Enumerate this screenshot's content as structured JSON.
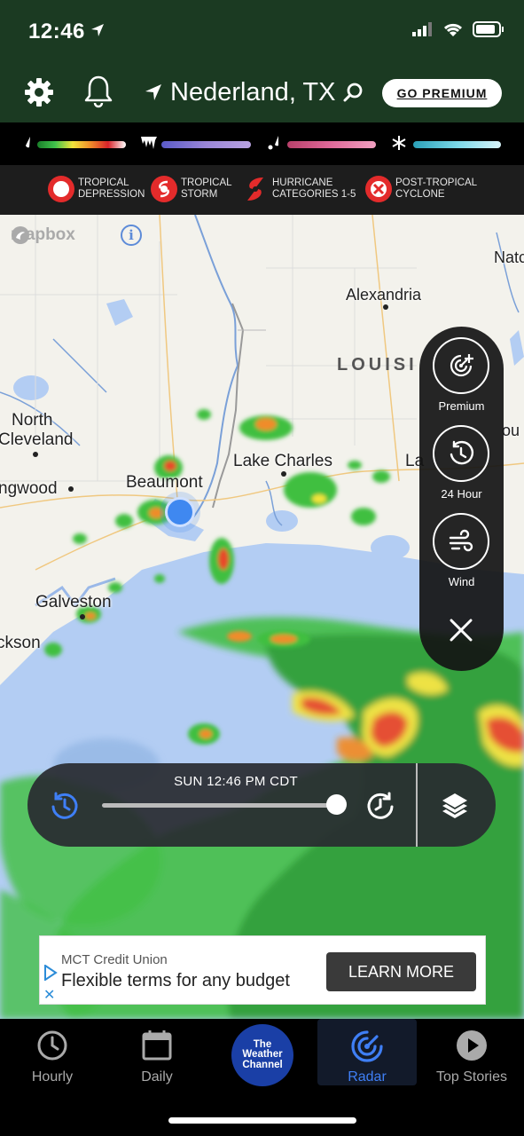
{
  "status_bar": {
    "time": "12:46"
  },
  "header": {
    "location": "Nederland, TX",
    "premium_button": "GO PREMIUM"
  },
  "legend": {
    "gradients": [
      {
        "name": "rain",
        "icon": "raindrop-icon",
        "colors": [
          "#1a7f2a",
          "#3fc24a",
          "#f2e43b",
          "#f08c2a",
          "#d8222a",
          "#ffffff"
        ]
      },
      {
        "name": "ice",
        "icon": "icicle-icon",
        "colors": [
          "#5a5ac8",
          "#9a86d8",
          "#b8a2e0"
        ]
      },
      {
        "name": "mix",
        "icon": "mix-icon",
        "colors": [
          "#b8406a",
          "#e06a9a",
          "#f0a0c0"
        ]
      },
      {
        "name": "snow",
        "icon": "snowflake-icon",
        "colors": [
          "#2aa0b8",
          "#7ad8e8",
          "#d8f4fa"
        ]
      }
    ],
    "storm_types": [
      {
        "label_line1": "TROPICAL",
        "label_line2": "DEPRESSION"
      },
      {
        "label_line1": "TROPICAL",
        "label_line2": "STORM"
      },
      {
        "label_line1": "HURRICANE",
        "label_line2": "CATEGORIES 1-5"
      },
      {
        "label_line1": "POST-TROPICAL",
        "label_line2": "CYCLONE"
      }
    ]
  },
  "map": {
    "attribution": "mapbox",
    "state_label": "LOUISI",
    "cities": [
      {
        "name": "Natc"
      },
      {
        "name": "Alexandria"
      },
      {
        "name": "North"
      },
      {
        "name": "Cleveland"
      },
      {
        "name": "ou"
      },
      {
        "name": "Lake Charles"
      },
      {
        "name": "La"
      },
      {
        "name": "ngwood"
      },
      {
        "name": "Beaumont"
      },
      {
        "name": "Galveston"
      },
      {
        "name": "ckson"
      }
    ]
  },
  "layer_panel": {
    "buttons": [
      {
        "label": "Premium",
        "icon": "radar-plus-icon"
      },
      {
        "label": "24 Hour",
        "icon": "history-24h-icon"
      },
      {
        "label": "Wind",
        "icon": "wind-icon"
      }
    ]
  },
  "timeline": {
    "time_label": "SUN 12:46 PM CDT",
    "progress": 0.98
  },
  "ad": {
    "advertiser": "MCT Credit Union",
    "headline": "Flexible terms for any budget",
    "cta": "LEARN MORE"
  },
  "tabs": [
    {
      "label": "Hourly",
      "icon": "clock-icon"
    },
    {
      "label": "Daily",
      "icon": "calendar-icon"
    },
    {
      "label": "The Weather Channel",
      "icon": "twc-logo"
    },
    {
      "label": "Radar",
      "icon": "radar-icon",
      "active": true
    },
    {
      "label": "Top Stories",
      "icon": "play-icon"
    }
  ],
  "twc_logo_lines": [
    "The",
    "Weather",
    "Channel"
  ],
  "colors": {
    "header_bg": "#1b3a22",
    "active_tab": "#3f7ff5",
    "water": "#b3cdf3",
    "land": "#f3f2ec"
  }
}
